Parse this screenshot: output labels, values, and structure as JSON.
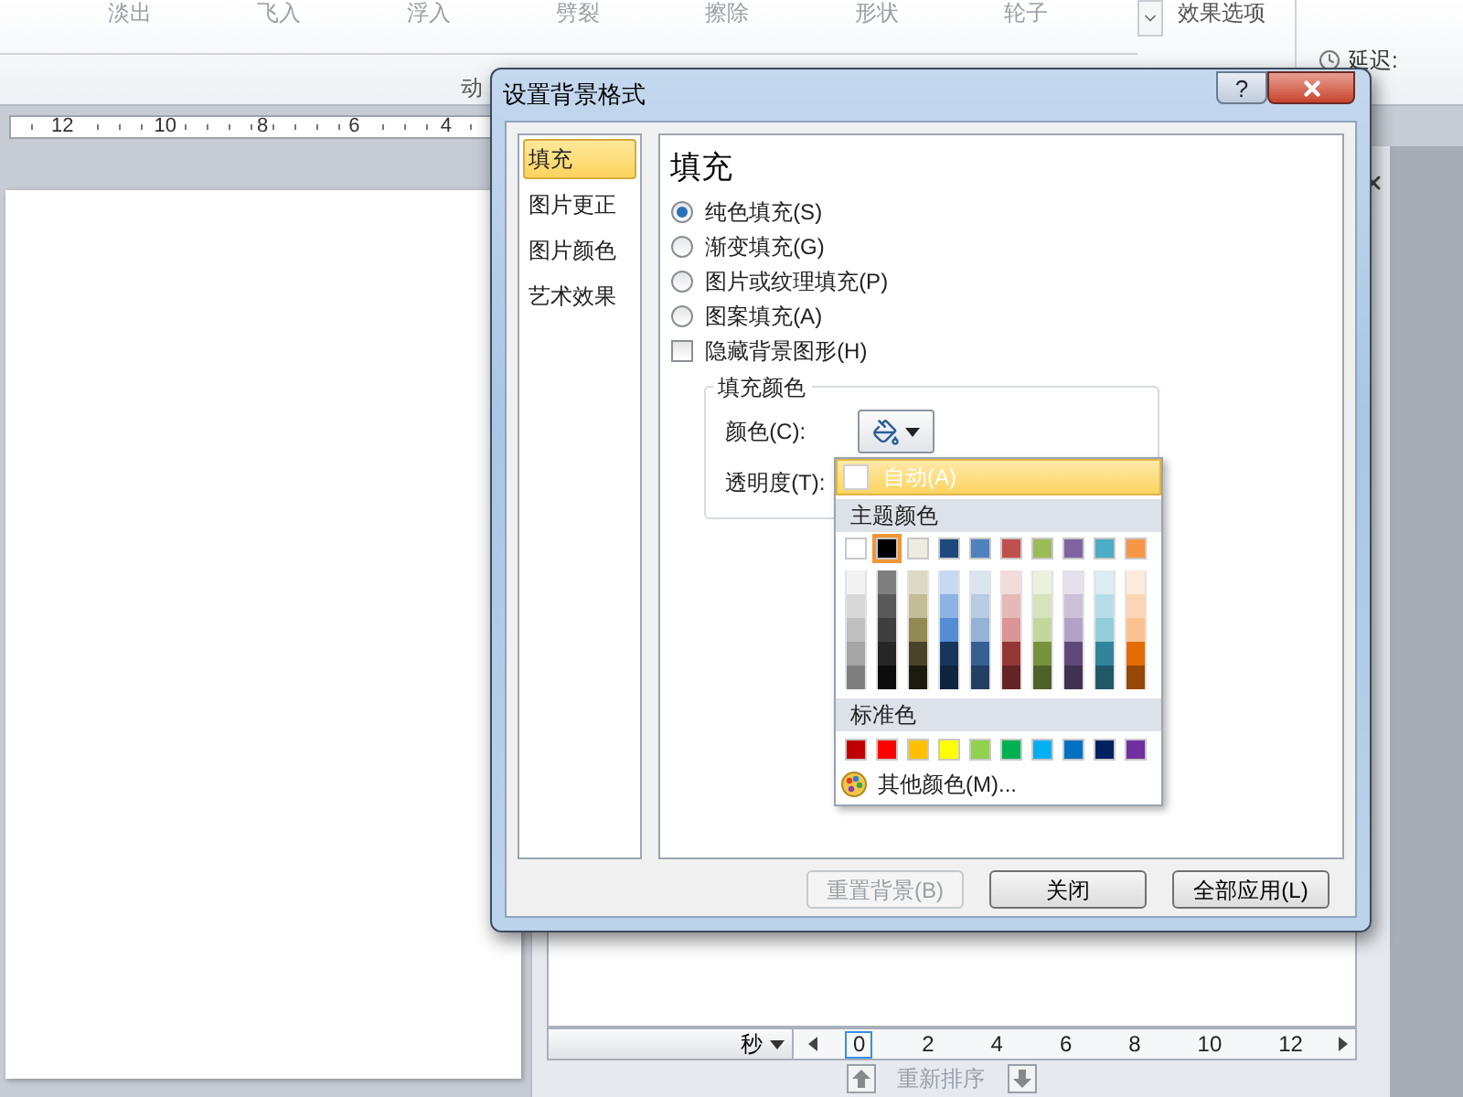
{
  "ribbon": {
    "gallery": [
      "淡出",
      "飞入",
      "浮入",
      "劈裂",
      "擦除",
      "形状",
      "轮子"
    ],
    "effect_options": "效果选项",
    "delay_label": "延迟:",
    "group_label": "动"
  },
  "ruler": {
    "labels": [
      "12",
      "10",
      "8",
      "6",
      "4"
    ]
  },
  "timeline": {
    "unit": "秒",
    "ticks": [
      {
        "label": "0",
        "selected": true
      },
      {
        "label": "2",
        "selected": false
      },
      {
        "label": "4",
        "selected": false
      },
      {
        "label": "6",
        "selected": false
      },
      {
        "label": "8",
        "selected": false
      },
      {
        "label": "10",
        "selected": false
      },
      {
        "label": "12",
        "selected": false
      }
    ],
    "reorder": "重新排序"
  },
  "dialog": {
    "title": "设置背景格式",
    "help": "?",
    "categories": [
      {
        "label": "填充",
        "selected": true
      },
      {
        "label": "图片更正",
        "selected": false
      },
      {
        "label": "图片颜色",
        "selected": false
      },
      {
        "label": "艺术效果",
        "selected": false
      }
    ],
    "heading": "填充",
    "fill_options": [
      {
        "label": "纯色填充(S)",
        "selected": true
      },
      {
        "label": "渐变填充(G)",
        "selected": false
      },
      {
        "label": "图片或纹理填充(P)",
        "selected": false
      },
      {
        "label": "图案填充(A)",
        "selected": false
      }
    ],
    "hide_graphics": {
      "label": "隐藏背景图形(H)",
      "checked": false
    },
    "group_title": "填充颜色",
    "color_label": "颜色(C):",
    "transparency_label": "透明度(T):",
    "buttons": [
      {
        "label": "重置背景(B)",
        "disabled": true
      },
      {
        "label": "关闭",
        "disabled": false
      },
      {
        "label": "全部应用(L)",
        "disabled": false
      }
    ]
  },
  "color_menu": {
    "auto": {
      "label": "自动(A)",
      "selected": true
    },
    "theme_title": "主题颜色",
    "theme_colors": [
      {
        "color": "#ffffff",
        "selected": false,
        "shades": [
          {
            "color": "#f2f2f2"
          },
          {
            "color": "#d8d8d8"
          },
          {
            "color": "#bfbfbf"
          },
          {
            "color": "#a5a5a5"
          },
          {
            "color": "#7f7f7f"
          }
        ]
      },
      {
        "color": "#000000",
        "selected": true,
        "shades": [
          {
            "color": "#7f7f7f"
          },
          {
            "color": "#595959"
          },
          {
            "color": "#3f3f3f"
          },
          {
            "color": "#262626"
          },
          {
            "color": "#0c0c0c"
          }
        ]
      },
      {
        "color": "#eeece1",
        "selected": false,
        "shades": [
          {
            "color": "#ddd9c3"
          },
          {
            "color": "#c4bd97"
          },
          {
            "color": "#938953"
          },
          {
            "color": "#494429"
          },
          {
            "color": "#1d1b10"
          }
        ]
      },
      {
        "color": "#1f497d",
        "selected": false,
        "shades": [
          {
            "color": "#c6d9f0"
          },
          {
            "color": "#8db3e2"
          },
          {
            "color": "#548dd4"
          },
          {
            "color": "#17365d"
          },
          {
            "color": "#0f243e"
          }
        ]
      },
      {
        "color": "#4f81bd",
        "selected": false,
        "shades": [
          {
            "color": "#dbe5f1"
          },
          {
            "color": "#b8cce4"
          },
          {
            "color": "#95b3d7"
          },
          {
            "color": "#366092"
          },
          {
            "color": "#244061"
          }
        ]
      },
      {
        "color": "#c0504d",
        "selected": false,
        "shades": [
          {
            "color": "#f2dcdb"
          },
          {
            "color": "#e5b9b7"
          },
          {
            "color": "#d99694"
          },
          {
            "color": "#953734"
          },
          {
            "color": "#632423"
          }
        ]
      },
      {
        "color": "#9bbb59",
        "selected": false,
        "shades": [
          {
            "color": "#ebf1dd"
          },
          {
            "color": "#d7e3bc"
          },
          {
            "color": "#c3d69b"
          },
          {
            "color": "#76923c"
          },
          {
            "color": "#4f6128"
          }
        ]
      },
      {
        "color": "#8064a2",
        "selected": false,
        "shades": [
          {
            "color": "#e5e0ec"
          },
          {
            "color": "#ccc1d9"
          },
          {
            "color": "#b2a2c7"
          },
          {
            "color": "#5f497a"
          },
          {
            "color": "#3f3151"
          }
        ]
      },
      {
        "color": "#4bacc6",
        "selected": false,
        "shades": [
          {
            "color": "#dbeef3"
          },
          {
            "color": "#b7dde8"
          },
          {
            "color": "#92cddc"
          },
          {
            "color": "#31859b"
          },
          {
            "color": "#205867"
          }
        ]
      },
      {
        "color": "#f79646",
        "selected": false,
        "shades": [
          {
            "color": "#fdeada"
          },
          {
            "color": "#fbd5b5"
          },
          {
            "color": "#fac08f"
          },
          {
            "color": "#e36c09"
          },
          {
            "color": "#974806"
          }
        ]
      }
    ],
    "standard_title": "标准色",
    "standard_colors": [
      {
        "color": "#c00000"
      },
      {
        "color": "#ff0000"
      },
      {
        "color": "#ffc000"
      },
      {
        "color": "#ffff00"
      },
      {
        "color": "#92d050"
      },
      {
        "color": "#00b050"
      },
      {
        "color": "#00b0f0"
      },
      {
        "color": "#0070c0"
      },
      {
        "color": "#002060"
      },
      {
        "color": "#7030a0"
      }
    ],
    "more": "其他颜色(M)..."
  }
}
